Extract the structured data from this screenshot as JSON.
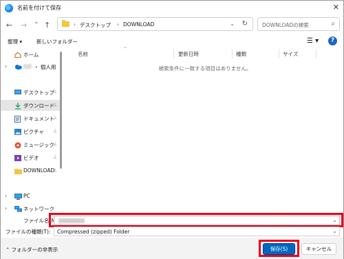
{
  "window": {
    "title": "名前を付けて保存",
    "close_glyph": "✕"
  },
  "nav_buttons": {
    "back": "←",
    "forward": "→",
    "recent": "⌄",
    "up": "↑"
  },
  "address": {
    "breadcrumbs": [
      "デスクトップ",
      "DOWNLOAD"
    ],
    "separator": "›",
    "dropdown": "⌄",
    "refresh": "↻"
  },
  "search": {
    "placeholder": "DOWNLOADの検索",
    "icon": "⌕"
  },
  "toolbar": {
    "organize": "整理 ▾",
    "new_folder": "新しいフォルダー",
    "view": "☰ ▾",
    "help": "?"
  },
  "sidebar": {
    "items": [
      {
        "label": "ホーム",
        "icon": "home-icon",
        "chevron": "",
        "pinned": false,
        "selected": false
      },
      {
        "label": "・ 個人用",
        "icon": "onedrive-icon",
        "chevron": "›",
        "pinned": false,
        "selected": false
      },
      {
        "label": "デスクトップ",
        "icon": "desktop-icon",
        "chevron": "",
        "pinned": true,
        "selected": false
      },
      {
        "label": "ダウンロード",
        "icon": "download-icon",
        "chevron": "",
        "pinned": true,
        "selected": true
      },
      {
        "label": "ドキュメント",
        "icon": "document-icon",
        "chevron": "",
        "pinned": true,
        "selected": false
      },
      {
        "label": "ピクチャ",
        "icon": "pictures-icon",
        "chevron": "",
        "pinned": true,
        "selected": false
      },
      {
        "label": "ミュージック",
        "icon": "music-icon",
        "chevron": "",
        "pinned": true,
        "selected": false
      },
      {
        "label": "ビデオ",
        "icon": "video-icon",
        "chevron": "",
        "pinned": true,
        "selected": false
      },
      {
        "label": "DOWNLOAD",
        "icon": "folder-icon",
        "chevron": "",
        "pinned": true,
        "selected": false
      },
      {
        "label": "PC",
        "icon": "pc-icon",
        "chevron": "›",
        "pinned": false,
        "selected": false
      },
      {
        "label": "ネットワーク",
        "icon": "network-icon",
        "chevron": "›",
        "pinned": false,
        "selected": false
      }
    ],
    "pin_glyph": "📌"
  },
  "file_list": {
    "columns": [
      "名前",
      "更新日時",
      "種類",
      "サイズ"
    ],
    "sort_indicator": "⌃",
    "empty_message": "検索条件に一致する項目はありません。"
  },
  "form": {
    "filename_label": "ファイル名(N):",
    "filename_value": "",
    "filetype_label": "ファイルの種類(T):",
    "filetype_value": "Compressed (zipped) Folder"
  },
  "footer": {
    "hide_folders": "⌃ フォルダーの非表示",
    "save": "保存(S)",
    "cancel": "キャンセル"
  },
  "colors": {
    "accent": "#0067c0",
    "highlight": "#e8001c",
    "selected_row": "#e5e5e5"
  }
}
